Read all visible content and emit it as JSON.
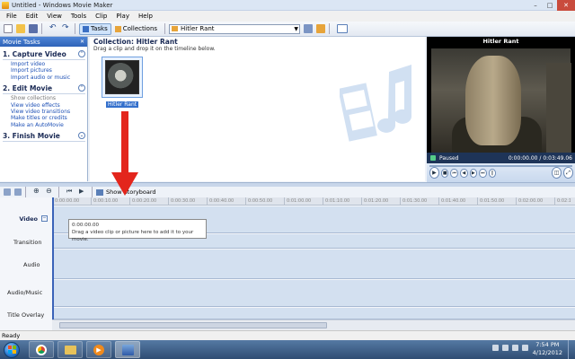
{
  "window": {
    "title": "Untitled - Windows Movie Maker",
    "minimize": "–",
    "maximize": "□",
    "close": "✕"
  },
  "menu": [
    "File",
    "Edit",
    "View",
    "Tools",
    "Clip",
    "Play",
    "Help"
  ],
  "toolbar": {
    "tasks_label": "Tasks",
    "collections_label": "Collections",
    "collection_select": "Hitler Rant"
  },
  "tasks_pane": {
    "header": "Movie Tasks",
    "sections": [
      {
        "title": "1. Capture Video",
        "links": [
          "Import video",
          "Import pictures",
          "Import audio or music"
        ]
      },
      {
        "title": "2. Edit Movie",
        "links": [
          "Show collections",
          "View video effects",
          "View video transitions",
          "Make titles or credits",
          "Make an AutoMovie"
        ]
      },
      {
        "title": "3. Finish Movie",
        "links": []
      }
    ]
  },
  "collection": {
    "title": "Collection: Hitler Rant",
    "subtitle": "Drag a clip and drop it on the timeline below.",
    "clip_label": "Hitler Rant"
  },
  "monitor": {
    "title": "Hitler Rant",
    "status": "Paused",
    "time": "0:00:00.00 / 0:03:49.06"
  },
  "storyboard": {
    "show_label": "Show Storyboard"
  },
  "timeline": {
    "ruler_ticks": [
      "0:00:00.00",
      "0:00:10.00",
      "0:00:20.00",
      "0:00:30.00",
      "0:00:40.00",
      "0:00:50.00",
      "0:01:00.00",
      "0:01:10.00",
      "0:01:20.00",
      "0:01:30.00",
      "0:01:40.00",
      "0:01:50.00",
      "0:02:00.00",
      "0:02:10.00"
    ],
    "tracks": [
      "Video",
      "Transition",
      "Audio",
      "Audio/Music",
      "Title Overlay"
    ],
    "tooltip": {
      "time": "0:00:00.00",
      "hint": "Drag a video clip or picture here to add it to your movie."
    }
  },
  "statusbar": {
    "text": "Ready"
  },
  "taskbar": {
    "time": "7:54 PM",
    "date": "4/12/2012"
  },
  "colors": {
    "arrow": "#e3251c",
    "accent": "#2f63b8",
    "taskbar": "#3a5a82"
  }
}
